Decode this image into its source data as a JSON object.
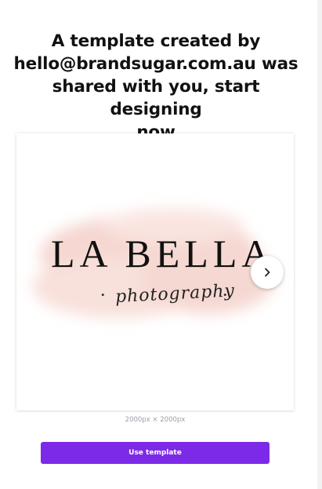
{
  "share_message": {
    "line1": "A template created by",
    "line2": "hello@brandsugar.com.au was",
    "line3": "shared with you, start designing",
    "line4": "now"
  },
  "template_preview": {
    "brand_name": "LA BELLA",
    "tagline": "photography",
    "bullet": "•",
    "wash_color": "#f4cfc8"
  },
  "carousel": {
    "next_icon": "chevron-right-icon"
  },
  "dimensions": "2000px × 2000px",
  "use_template": {
    "label": "Use template",
    "color": "#7d2ae8"
  }
}
